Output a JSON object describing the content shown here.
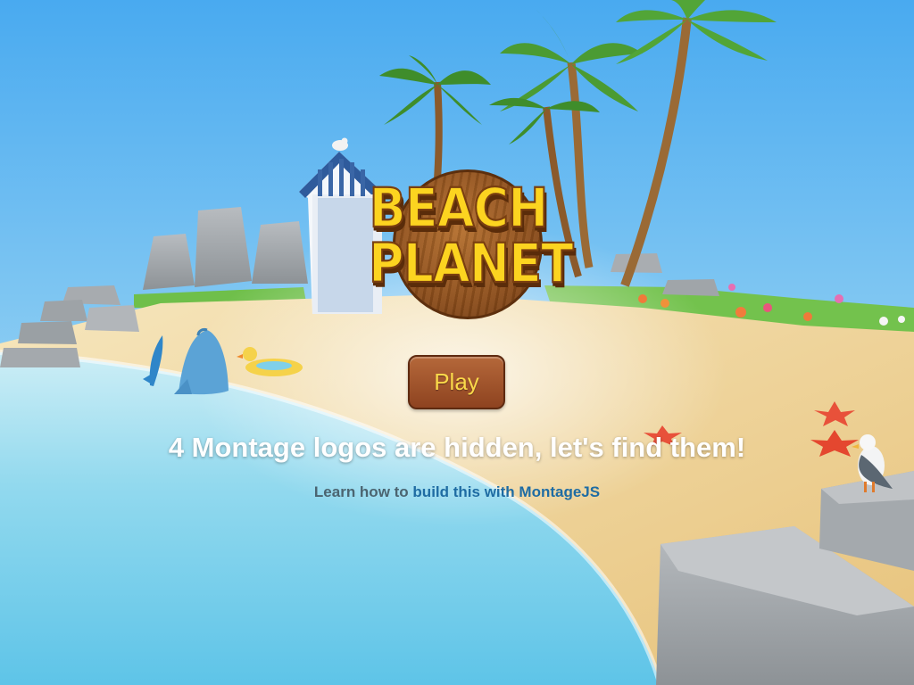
{
  "game": {
    "logo_line1": "BEACH",
    "logo_line2": "PLANET",
    "play_label": "Play",
    "tagline": "4 Montage logos are hidden, let's find them!",
    "learn_prefix": "Learn how to",
    "learn_link": "build this with MontageJS"
  },
  "colors": {
    "sky": "#5cb8f2",
    "sea": "#7fd0ea",
    "sand": "#f0d79a",
    "play_button": "#a35a2c",
    "play_text": "#fbd94a",
    "logo_text": "#fcd420",
    "link": "#1f6ca3"
  }
}
